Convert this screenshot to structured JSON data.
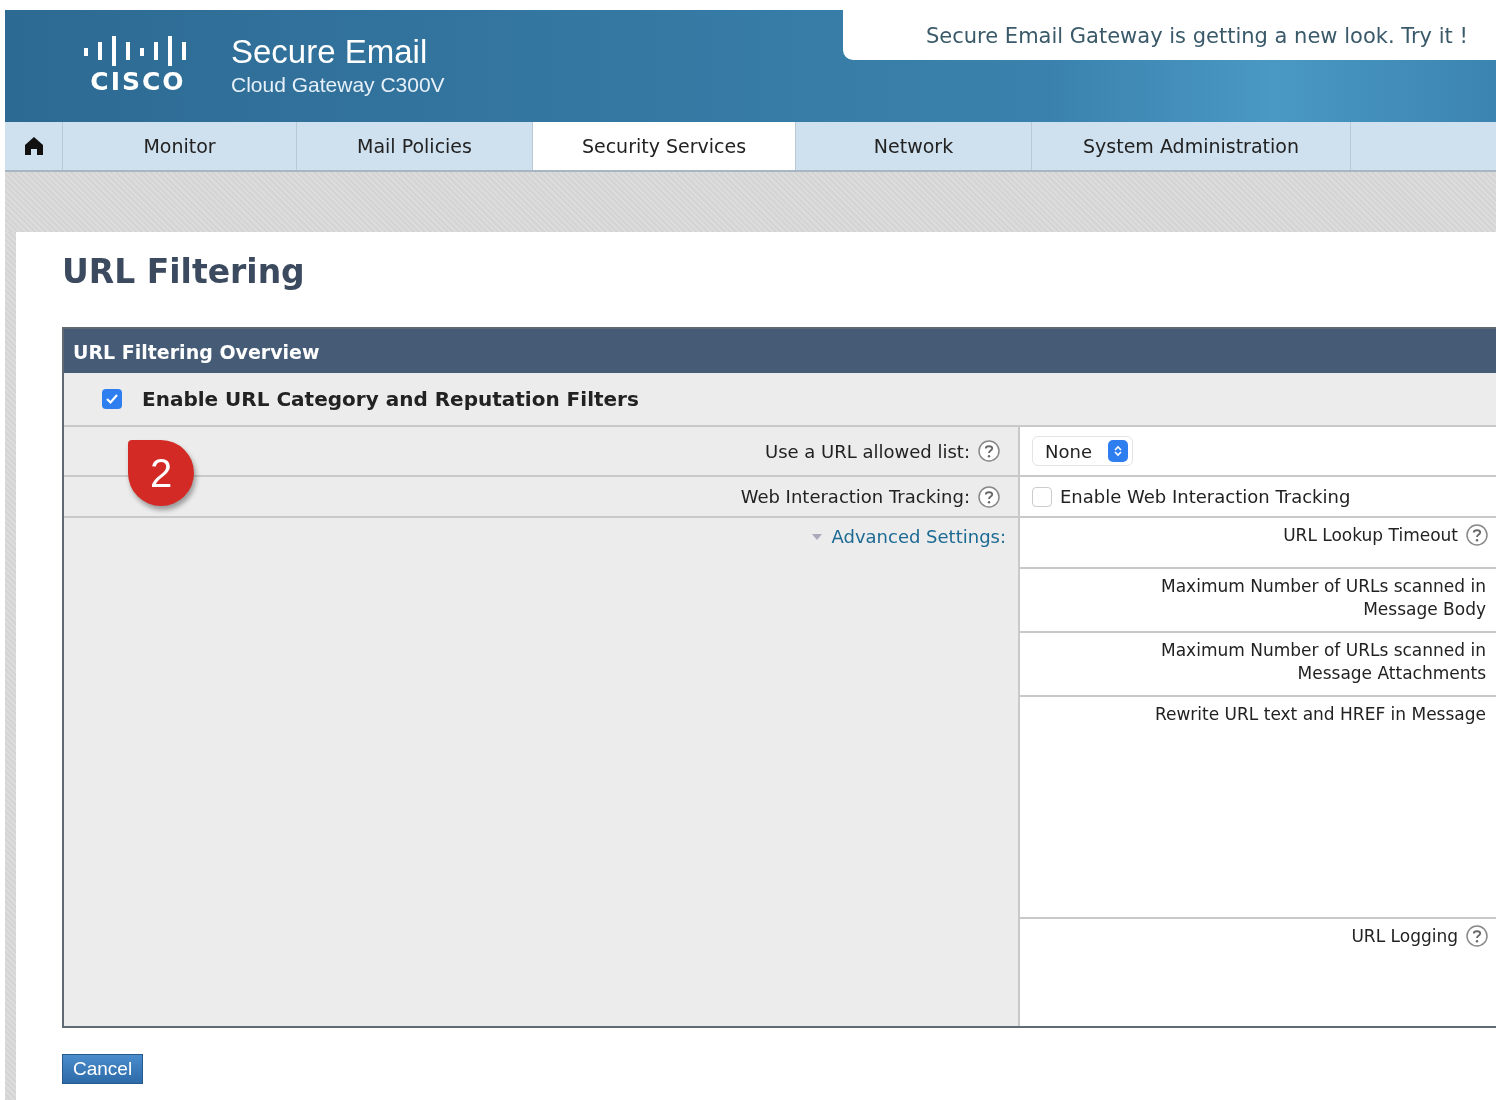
{
  "header": {
    "logo_text": "CISCO",
    "product": "Secure Email",
    "model": "Cloud Gateway C300V",
    "notice": "Secure Email Gateway is getting a new look. Try it !"
  },
  "nav": [
    {
      "label": "Monitor",
      "selected": false
    },
    {
      "label": "Mail Policies",
      "selected": false
    },
    {
      "label": "Security Services",
      "selected": true
    },
    {
      "label": "Network",
      "selected": false
    },
    {
      "label": "System Administration",
      "selected": false
    }
  ],
  "page_title": "URL Filtering",
  "section": {
    "title": "URL Filtering Overview",
    "enable": {
      "label": "Enable URL Category and Reputation Filters",
      "checked": true
    },
    "rows": [
      {
        "label": "Use a URL allowed list:",
        "help": true,
        "control": {
          "kind": "select",
          "value": "None"
        }
      },
      {
        "label": "Web Interaction Tracking:",
        "help": true,
        "control": {
          "kind": "checkbox",
          "label": "Enable Web Interaction Tracking",
          "checked": false
        }
      }
    ],
    "advanced": {
      "label": "Advanced Settings:",
      "expanded": true,
      "items": [
        {
          "label": "URL Lookup Timeout",
          "help": true
        },
        {
          "label": "Maximum Number of URLs scanned in Message Body",
          "help": false
        },
        {
          "label": "Maximum Number of URLs scanned in Message Attachments",
          "help": false
        },
        {
          "label": "Rewrite URL text and HREF in Message",
          "help": false
        },
        {
          "label": "URL Logging",
          "help": true
        }
      ]
    }
  },
  "callout": "2",
  "buttons": [
    {
      "label": "Cancel"
    }
  ]
}
